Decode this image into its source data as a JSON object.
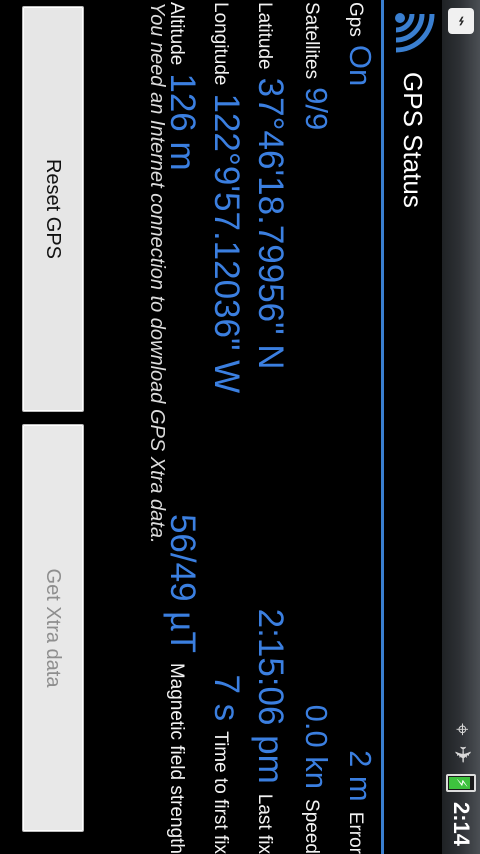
{
  "statusbar": {
    "usb_icon": "usb-icon",
    "gps_icon": "gps-target-icon",
    "airplane_icon": "airplane-icon",
    "battery_icon": "battery-charging-icon",
    "time": "2:14"
  },
  "header": {
    "title": "GPS Status",
    "icon": "gps-signal-icon",
    "accent": "#3a7fd0"
  },
  "left_fields": [
    {
      "label": "Gps",
      "value": "On"
    },
    {
      "label": "Satellites",
      "value": "9/9"
    },
    {
      "label": "Latitude",
      "value": "37°46'18.79956\" N"
    },
    {
      "label": "Longitude",
      "value": "122°9'57.12036\" W"
    },
    {
      "label": "Altitude",
      "value": "126 m"
    }
  ],
  "right_fields": [
    {
      "label": "Error",
      "value": "2 m"
    },
    {
      "label": "Speed",
      "value": "0.0 kn"
    },
    {
      "label": "Last fix",
      "value": "2:15:06 pm"
    },
    {
      "label": "Time to first fix",
      "value": "7 s"
    },
    {
      "label": "Magnetic field strength",
      "value": "56/49 µT"
    }
  ],
  "note": "You need an Internet connection to download GPS Xtra data.",
  "buttons": {
    "reset": "Reset GPS",
    "xtra": "Get Xtra data"
  },
  "colors": {
    "value_blue": "#3b7fe0",
    "background": "#000000"
  }
}
